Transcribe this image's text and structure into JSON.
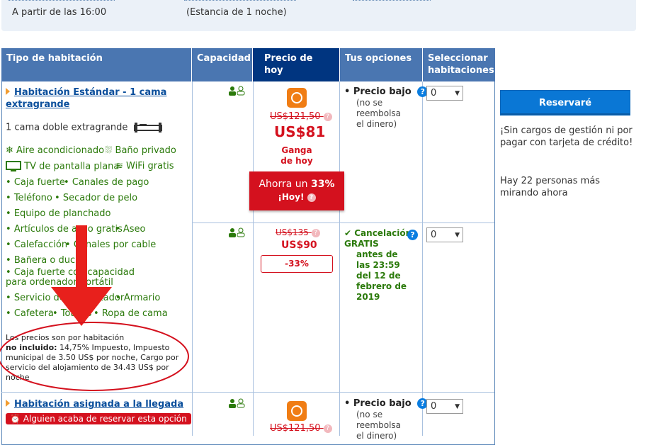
{
  "info": {
    "checkin_time": "A partir de las 16:00",
    "stay_length": "(Estancia de 1 noche)"
  },
  "headers": {
    "room_type": "Tipo de habitación",
    "capacity": "Capacidad",
    "price_today": "Precio de hoy",
    "options": "Tus opciones",
    "select_rooms": "Seleccionar habitaciones"
  },
  "room1": {
    "name": "Habitación Estándar - 1 cama extragrande",
    "bed": "1 cama doble extragrande",
    "facilities_main": [
      "Aire acondicionado",
      "Baño privado",
      "TV de pantalla plana",
      "WiFi gratis"
    ],
    "facilities": [
      "Caja fuerte",
      "Canales de pago",
      "Teléfono",
      "Secador de pelo",
      "Equipo de planchado",
      "Artículos de aseo gratis",
      "Aseo",
      "Calefacción",
      "Canales por cable",
      "Bañera o ducha",
      "Caja fuerte con capacidad para ordenador portátil",
      "Servicio de despertador",
      "Armario",
      "Cafetera",
      "Toallas",
      "Ropa de cama"
    ],
    "price_note": "Los precios son por habitación",
    "not_included_label": "no incluido:",
    "not_included_text": "14,75% Impuesto, Impuesto municipal de 3.50 US$ por noche, Cargo por servicio del alojamiento de 34.43 US$ por noche",
    "offer1": {
      "old_price": "US$121,50",
      "price": "US$81",
      "deal_line1": "Ganga",
      "deal_line2": "de hoy",
      "save_label": "Ahorra un",
      "save_pct": "33%",
      "save_today": "¡Hoy!",
      "option_title": "Precio bajo",
      "option_sub": "(no se reembolsa el dinero)",
      "qty": "0"
    },
    "offer2": {
      "old_price": "US$135",
      "price": "US$90",
      "discount": "-33%",
      "option_title": "Cancelación GRATIS",
      "option_sub": "antes de las 23:59 del 12 de febrero de 2019",
      "qty": "0"
    }
  },
  "room2": {
    "name": "Habitación asignada a la llegada",
    "alert": "Alguien acaba de reservar esta opción",
    "old_price": "US$121,50",
    "option_title": "Precio bajo",
    "option_sub": "(no se reembolsa el dinero)",
    "qty": "0"
  },
  "sidebar": {
    "reserve_label": "Reservaré",
    "no_fees": "¡Sin cargos de gestión ni por pagar con tarjeta de crédito!",
    "viewers": "Hay 22 personas más mirando ahora"
  },
  "colors": {
    "header_blue": "#4a76b1",
    "header_dark": "#003580",
    "price_red": "#d4111e",
    "green": "#2b7a0b",
    "button_blue": "#0a77d5",
    "annotation_red": "#e8201c"
  }
}
